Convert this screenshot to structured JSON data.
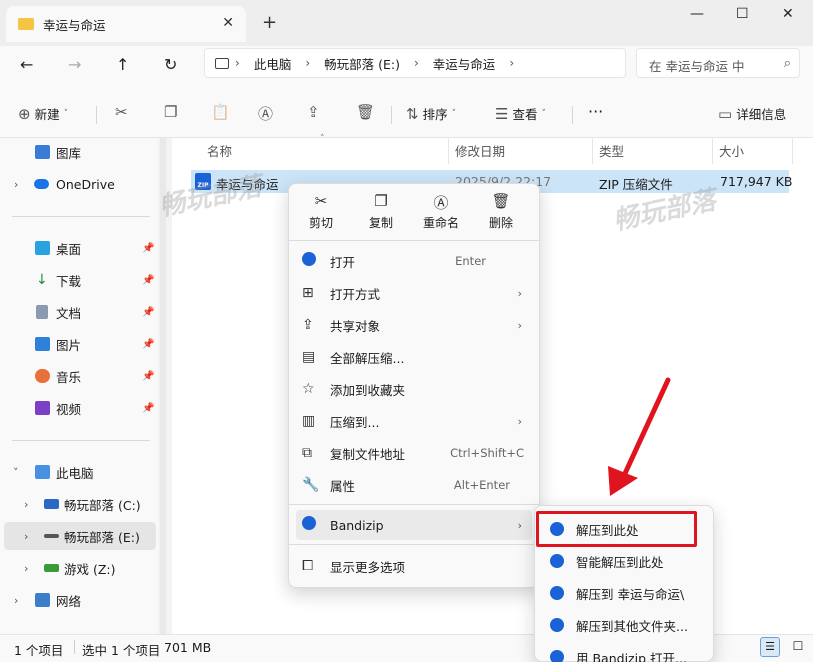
{
  "tab": {
    "title": "幸运与命运",
    "close": "✕",
    "new_tab": "+"
  },
  "window": {
    "minimize": "—",
    "maximize": "☐",
    "close": "✕"
  },
  "breadcrumb": [
    "此电脑",
    "畅玩部落 (E:)",
    "幸运与命运"
  ],
  "search": {
    "placeholder": "在 幸运与命运 中"
  },
  "toolbar": {
    "new": "新建",
    "sort": "排序",
    "view": "查看",
    "more": "···",
    "details": "详细信息"
  },
  "sidebar": {
    "items": [
      {
        "label": "图库"
      },
      {
        "label": "OneDrive"
      },
      {
        "label": "桌面"
      },
      {
        "label": "下载"
      },
      {
        "label": "文档"
      },
      {
        "label": "图片"
      },
      {
        "label": "音乐"
      },
      {
        "label": "视频"
      },
      {
        "label": "此电脑"
      },
      {
        "label": "畅玩部落 (C:)"
      },
      {
        "label": "畅玩部落 (E:)"
      },
      {
        "label": "游戏 (Z:)"
      },
      {
        "label": "网络"
      }
    ]
  },
  "columns": {
    "name": "名称",
    "date": "修改日期",
    "type": "类型",
    "size": "大小"
  },
  "file": {
    "name": "幸运与命运",
    "date": "2025/9/2 22:17",
    "type": "ZIP 压缩文件",
    "size": "717,947 KB",
    "icon_text": "ZIP"
  },
  "context_menu": {
    "quick": {
      "cut": "剪切",
      "copy": "复制",
      "rename": "重命名",
      "delete": "删除"
    },
    "items": [
      {
        "label": "打开",
        "shortcut": "Enter"
      },
      {
        "label": "打开方式"
      },
      {
        "label": "共享对象"
      },
      {
        "label": "全部解压缩..."
      },
      {
        "label": "添加到收藏夹"
      },
      {
        "label": "压缩到..."
      },
      {
        "label": "复制文件地址",
        "shortcut": "Ctrl+Shift+C"
      },
      {
        "label": "属性",
        "shortcut": "Alt+Enter"
      },
      {
        "label": "Bandizip"
      },
      {
        "label": "显示更多选项"
      }
    ]
  },
  "submenu": {
    "items": [
      {
        "label": "解压到此处"
      },
      {
        "label": "智能解压到此处"
      },
      {
        "label": "解压到 幸运与命运\\"
      },
      {
        "label": "解压到其他文件夹..."
      },
      {
        "label": "用 Bandizip 打开..."
      }
    ]
  },
  "status": {
    "count": "1 个项目",
    "selected": "选中 1 个项目",
    "size": "701 MB"
  },
  "watermark": "畅玩部落",
  "colors": {
    "accent": "#1b62d6",
    "highlight_box": "#e0141e",
    "selection": "#cce4f7"
  }
}
